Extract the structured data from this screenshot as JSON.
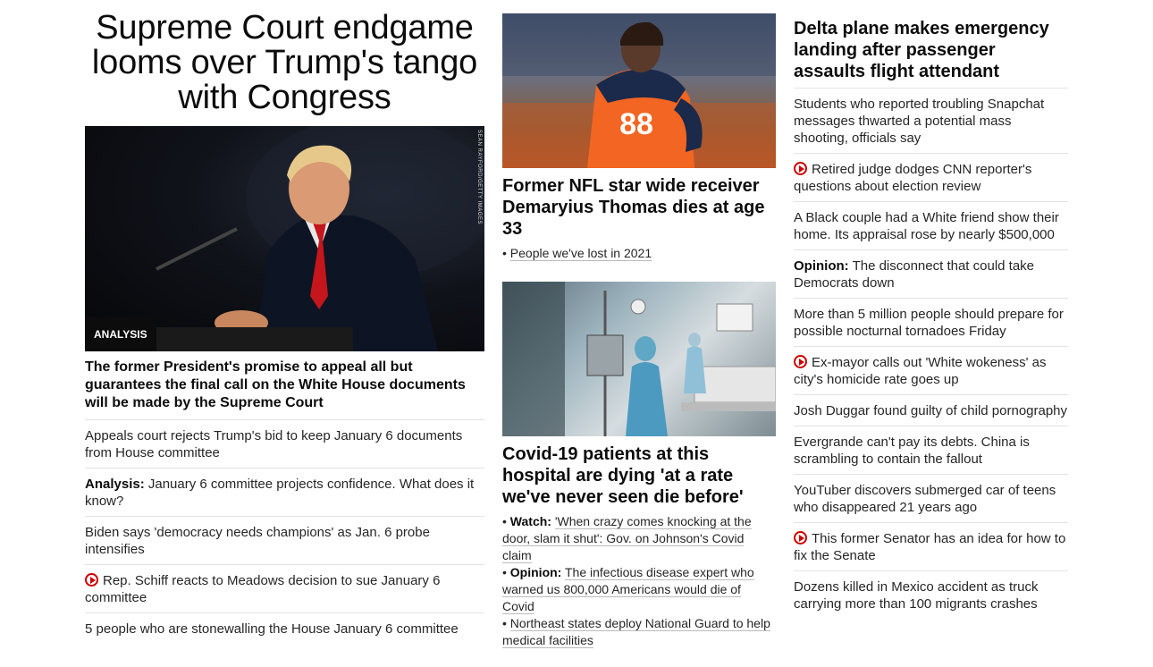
{
  "lead": {
    "headline": "Supreme Court endgame looms over Trump's tango with Congress",
    "image_credit": "SEAN RAYFORD/GETTY IMAGES",
    "badge": "ANALYSIS",
    "subhead": "The former President's promise to appeal all but guarantees the final call on the White House documents will be made by the Supreme Court",
    "related": [
      {
        "prefix": "",
        "text": "Appeals court rejects Trump's bid to keep January 6 documents from House committee",
        "video": false
      },
      {
        "prefix": "Analysis:",
        "text": "January 6 committee projects confidence. What does it know?",
        "video": false
      },
      {
        "prefix": "",
        "text": "Biden says 'democracy needs champions' as Jan. 6 probe intensifies",
        "video": false
      },
      {
        "prefix": "",
        "text": "Rep. Schiff reacts to Meadows decision to sue January 6 committee",
        "video": true
      },
      {
        "prefix": "",
        "text": "5 people who are stonewalling the House January 6 committee",
        "video": false
      }
    ]
  },
  "middle": {
    "story1": {
      "headline": "Former NFL star wide receiver Demaryius Thomas dies at age 33",
      "jersey": "88",
      "bullets": [
        {
          "prefix": "",
          "text": "People we've lost in 2021"
        }
      ]
    },
    "story2": {
      "headline": "Covid-19 patients at this hospital are dying 'at a rate we've never seen die before'",
      "bullets": [
        {
          "prefix": "Watch:",
          "text": "'When crazy comes knocking at the door, slam it shut': Gov. on Johnson's Covid claim"
        },
        {
          "prefix": "Opinion:",
          "text": "The infectious disease expert who warned us 800,000 Americans would die of Covid"
        },
        {
          "prefix": "",
          "text": "Northeast states deploy National Guard to help medical facilities"
        }
      ]
    }
  },
  "right": {
    "headline": "Delta plane makes emergency landing after passenger assaults flight attendant",
    "items": [
      {
        "prefix": "",
        "text": "Students who reported troubling Snapchat messages thwarted a potential mass shooting, officials say",
        "video": false
      },
      {
        "prefix": "",
        "text": "Retired judge dodges CNN reporter's questions about election review",
        "video": true
      },
      {
        "prefix": "",
        "text": "A Black couple had a White friend show their home. Its appraisal rose by nearly $500,000",
        "video": false
      },
      {
        "prefix": "Opinion:",
        "text": "The disconnect that could take Democrats down",
        "video": false
      },
      {
        "prefix": "",
        "text": "More than 5 million people should prepare for possible nocturnal tornadoes Friday",
        "video": false
      },
      {
        "prefix": "",
        "text": "Ex-mayor calls out 'White wokeness' as city's homicide rate goes up",
        "video": true
      },
      {
        "prefix": "",
        "text": "Josh Duggar found guilty of child pornography",
        "video": false
      },
      {
        "prefix": "",
        "text": "Evergrande can't pay its debts. China is scrambling to contain the fallout",
        "video": false
      },
      {
        "prefix": "",
        "text": "YouTuber discovers submerged car of teens who disappeared 21 years ago",
        "video": false
      },
      {
        "prefix": "",
        "text": "This former Senator has an idea for how to fix the Senate",
        "video": true
      },
      {
        "prefix": "",
        "text": "Dozens killed in Mexico accident as truck carrying more than 100 migrants crashes",
        "video": false
      }
    ]
  },
  "colors": {
    "video_red": "#cc0000",
    "text": "#262626",
    "divider": "#e3e3e3"
  }
}
